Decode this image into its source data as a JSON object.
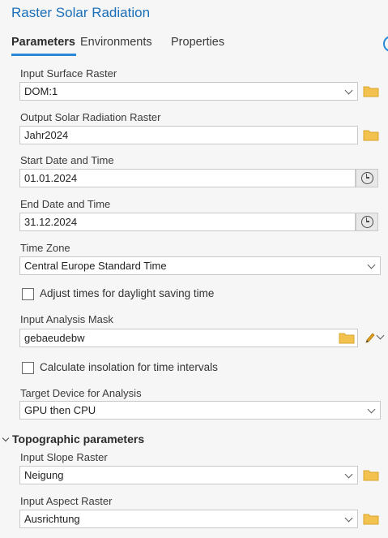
{
  "title": "Raster Solar Radiation",
  "tabs": [
    "Parameters",
    "Environments",
    "Properties"
  ],
  "fields": {
    "input_surface_raster": {
      "label": "Input Surface Raster",
      "value": "DOM:1"
    },
    "output_raster": {
      "label": "Output Solar Radiation Raster",
      "value": "Jahr2024"
    },
    "start_date": {
      "label": "Start Date and Time",
      "value": "01.01.2024"
    },
    "end_date": {
      "label": "End Date and Time",
      "value": "31.12.2024"
    },
    "time_zone": {
      "label": "Time Zone",
      "value": "Central Europe Standard Time"
    },
    "analysis_mask": {
      "label": "Input Analysis Mask",
      "value": "gebaeudebw"
    },
    "target_device": {
      "label": "Target Device for Analysis",
      "value": "GPU then CPU"
    },
    "slope_raster": {
      "label": "Input Slope Raster",
      "value": "Neigung"
    },
    "aspect_raster": {
      "label": "Input Aspect Raster",
      "value": "Ausrichtung"
    }
  },
  "checkboxes": {
    "daylight_saving": {
      "label": "Adjust times for daylight saving time",
      "checked": false
    },
    "time_intervals": {
      "label": "Calculate insolation for time intervals",
      "checked": false
    }
  },
  "sections": {
    "topographic": "Topographic parameters"
  },
  "icons": {
    "folder": "folder-icon",
    "clock": "clock-icon",
    "chevron": "chevron-down-icon",
    "pencil": "pencil-icon"
  },
  "colors": {
    "title": "#1a6fb8",
    "tab_accent": "#2a88d8",
    "folder": "#f2c14e",
    "pencil": "#e0a020"
  }
}
